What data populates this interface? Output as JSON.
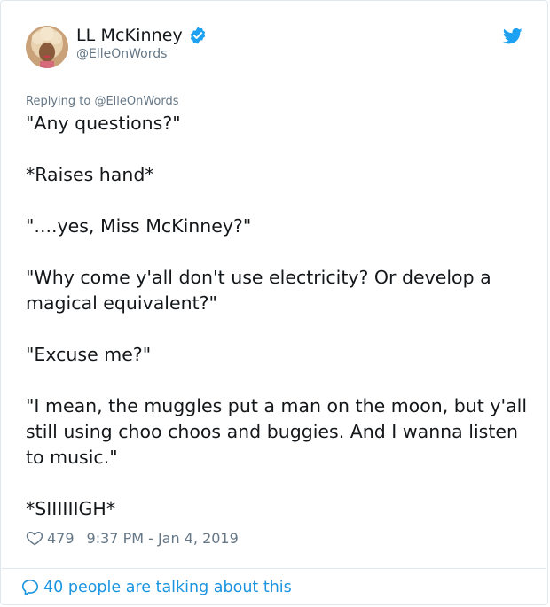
{
  "author": {
    "display_name": "LL McKinney",
    "handle": "@ElleOnWords"
  },
  "reply": {
    "prefix": "Replying to ",
    "to": "@ElleOnWords"
  },
  "tweet": {
    "paragraphs": [
      "\"Any questions?\"",
      "*Raises hand*",
      "\"....yes, Miss McKinney?\"",
      "\"Why come y'all don't use electricity? Or develop a magical equivalent?\"",
      "\"Excuse me?\"",
      "\"I mean, the muggles put a man on the moon, but y'all still using choo choos and buggies. And I wanna listen to music.\"",
      "*SIIIIIIGH*"
    ]
  },
  "meta": {
    "likes": "479",
    "timestamp": "9:37 PM - Jan 4, 2019"
  },
  "footer": {
    "talking": "40 people are talking about this"
  },
  "colors": {
    "brand": "#1da1f2",
    "link": "#1b95e0",
    "muted": "#657786"
  },
  "icons": {
    "avatar": "user-avatar",
    "verified": "verified-badge-icon",
    "logo": "twitter-bird-icon",
    "like": "heart-icon",
    "replies": "speech-bubble-icon"
  }
}
